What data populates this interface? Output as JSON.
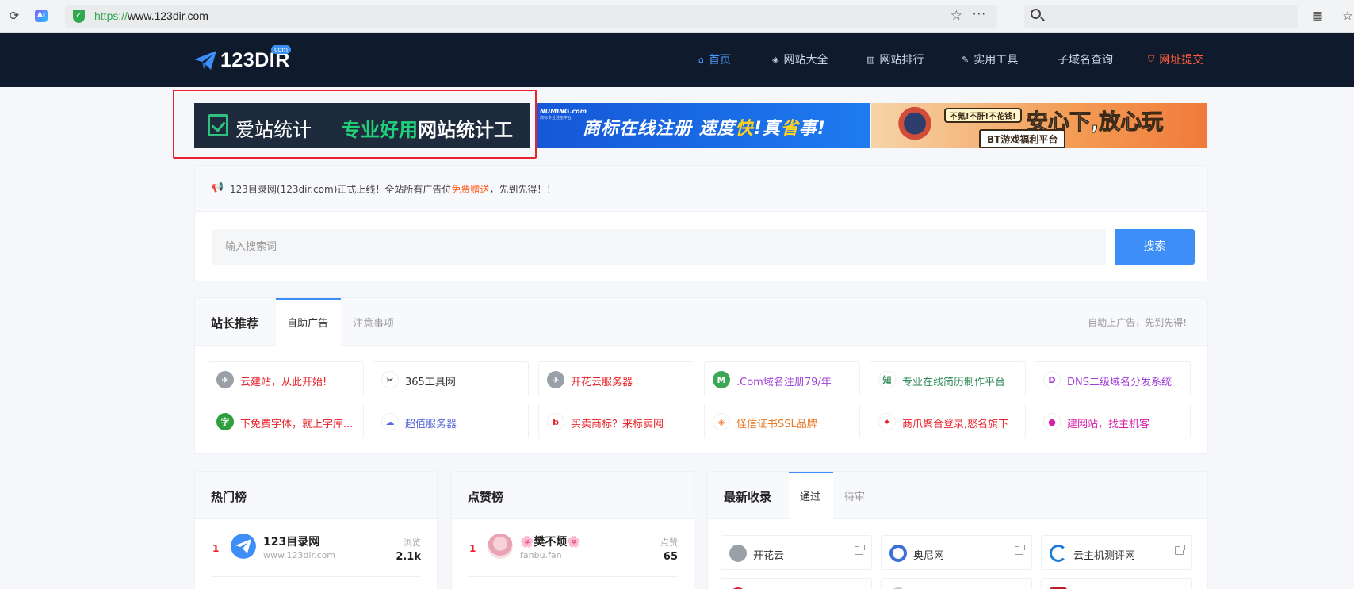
{
  "browser": {
    "url_scheme": "https://",
    "url_host": "www.123dir.com",
    "ai_badge": "AI"
  },
  "header": {
    "logo_text": "123DIR",
    "logo_badge": "com",
    "nav": [
      {
        "label": "首页",
        "icon": "home-icon",
        "active": true
      },
      {
        "label": "网站大全",
        "icon": "layers-icon"
      },
      {
        "label": "网站排行",
        "icon": "bar-chart-icon"
      },
      {
        "label": "实用工具",
        "icon": "tools-icon"
      },
      {
        "label": "子域名查询",
        "icon": ""
      },
      {
        "label": "网址提交",
        "icon": "shield-icon",
        "highlight": true
      }
    ]
  },
  "banners": {
    "b1": {
      "brand": "爱站统计",
      "slogan_green": "专业好用",
      "slogan_white": "网站统计工具"
    },
    "b2": {
      "logo": "NUMING.com",
      "logo_sub": "商标专业注册平台",
      "text_a": "商标在线注册 速度",
      "text_fast": "快",
      "text_b": "!",
      "text_c": "真",
      "text_save": "省",
      "text_d": "事!"
    },
    "b3": {
      "tag": "不氪!不肝!不花钱!",
      "big_a": "安心下,",
      "big_b": "放心",
      "big_c": "玩",
      "sub": "BT游戏福利平台"
    }
  },
  "notice": {
    "prefix": "123目录网(123dir.com)正式上线！全站所有广告位",
    "highlight": "免费赠送",
    "suffix": "，先到先得！！"
  },
  "search": {
    "placeholder": "输入搜索词",
    "button": "搜索"
  },
  "recommend": {
    "title": "站长推荐",
    "tabs": [
      "自助广告",
      "注意事项"
    ],
    "right_text": "自助上广告，先到先得!",
    "items": [
      {
        "label": "云建站，从此开始!",
        "color": "#e8232b",
        "icon_color": "#9aa0a8",
        "glyph": "✈"
      },
      {
        "label": "365工具网",
        "color": "#333333",
        "icon_color": "#ffffff",
        "glyph": "✂"
      },
      {
        "label": "开花云服务器",
        "color": "#e8232b",
        "icon_color": "#9aa0a8",
        "glyph": "✈"
      },
      {
        "label": ".Com域名注册79/年",
        "color": "#a040d8",
        "icon_color": "#3aa856",
        "glyph": "M"
      },
      {
        "label": "专业在线简历制作平台",
        "color": "#2e8b57",
        "icon_color": "#ffffff",
        "glyph": "知"
      },
      {
        "label": "DNS二级域名分发系统",
        "color": "#a040d8",
        "icon_color": "#ffffff",
        "glyph": "D"
      },
      {
        "label": "下免费字体，就上字库...",
        "color": "#e8232b",
        "icon_color": "#2e9e3e",
        "glyph": "字"
      },
      {
        "label": "超值服务器",
        "color": "#5a6ad8",
        "icon_color": "#ffffff",
        "glyph": "☁"
      },
      {
        "label": "买卖商标？来标卖网",
        "color": "#e8232b",
        "icon_color": "#ffffff",
        "glyph": "b"
      },
      {
        "label": "怪信证书SSL品牌",
        "color": "#e87a2b",
        "icon_color": "#ffffff",
        "glyph": "◈"
      },
      {
        "label": "商爪聚合登录,怒名旗下",
        "color": "#e8232b",
        "icon_color": "#ffffff",
        "glyph": "✦"
      },
      {
        "label": "建网站，找主机客",
        "color": "#d61faa",
        "icon_color": "#ffffff",
        "glyph": "●"
      }
    ]
  },
  "hot": {
    "title": "热门榜",
    "rank": "1",
    "name": "123目录网",
    "url": "www.123dir.com",
    "label": "浏览",
    "value": "2.1k"
  },
  "like": {
    "title": "点赞榜",
    "rank": "1",
    "name": "🌸樊不烦🌸",
    "url": "fanbu.fan",
    "label": "点赞",
    "value": "65"
  },
  "newest": {
    "title": "最新收录",
    "tabs": [
      "通过",
      "待审"
    ],
    "items": [
      {
        "label": "开花云"
      },
      {
        "label": "奥尼网"
      },
      {
        "label": "云主机测评网"
      }
    ]
  }
}
